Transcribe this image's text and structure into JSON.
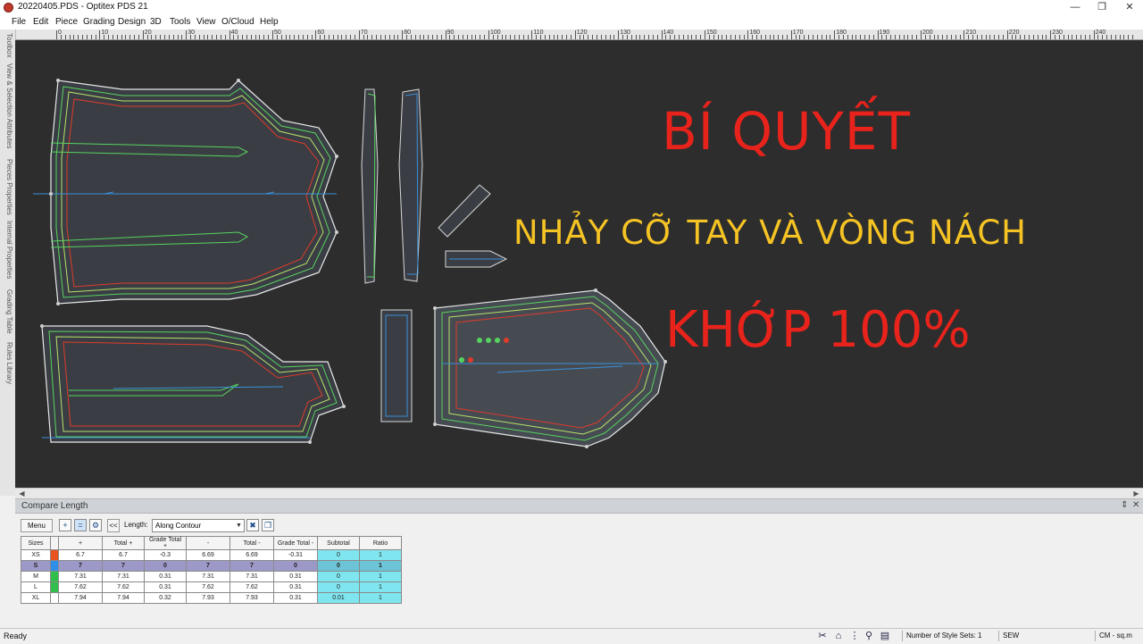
{
  "window": {
    "title": "20220405.PDS - Optitex PDS 21",
    "controls": {
      "minimize": "—",
      "maximize": "❐",
      "close": "✕"
    }
  },
  "menu": [
    "File",
    "Edit",
    "Piece",
    "Grading",
    "Design",
    "3D",
    "Tools",
    "View",
    "O/Cloud",
    "Help"
  ],
  "ruler": {
    "labels": [
      "0",
      "10",
      "20",
      "30",
      "40",
      "50",
      "60",
      "70",
      "80",
      "90",
      "100",
      "110",
      "120",
      "130",
      "140",
      "150",
      "160",
      "170",
      "180",
      "190",
      "200",
      "210",
      "220",
      "230",
      "240"
    ]
  },
  "side_tabs": [
    "Toolbox",
    "View & Selection Attributes",
    "Pieces Properties",
    "Internal Properties",
    "Grading Table",
    "Rules Library"
  ],
  "overlay": {
    "line1": "BÍ QUYẾT",
    "line2": "NHẢY CỠ TAY VÀ VÒNG NÁCH",
    "line3": "KHỚP 100%",
    "colors": {
      "red": "#e8231c",
      "yellow": "#f5c324"
    }
  },
  "panel": {
    "title": "Compare Length",
    "pin_icons": [
      "pin-icon",
      "close-icon"
    ],
    "menu_button": "Menu",
    "nav_button": "<<",
    "length_label": "Length:",
    "length_mode": "Along Contour",
    "table": {
      "headers": [
        "Sizes",
        "",
        "+",
        "Total +",
        "Grade Total +",
        "-",
        "Total -",
        "Grade Total -",
        "Subtotal",
        "Ratio"
      ],
      "rows": [
        {
          "size": "XS",
          "color": "#e8531f",
          "plus": "6.7",
          "total_plus": "6.7",
          "grade_plus": "-0.3",
          "minus": "6.69",
          "total_minus": "6.69",
          "grade_minus": "-0.31",
          "subtotal": "0",
          "ratio": "1"
        },
        {
          "size": "S",
          "color": "#2f8fe8",
          "plus": "7",
          "total_plus": "7",
          "grade_plus": "0",
          "minus": "7",
          "total_minus": "7",
          "grade_minus": "0",
          "subtotal": "0",
          "ratio": "1",
          "selected": true
        },
        {
          "size": "M",
          "color": "#2fbf4a",
          "plus": "7.31",
          "total_plus": "7.31",
          "grade_plus": "0.31",
          "minus": "7.31",
          "total_minus": "7.31",
          "grade_minus": "0.31",
          "subtotal": "0",
          "ratio": "1"
        },
        {
          "size": "L",
          "color": "#2fbf4a",
          "plus": "7.62",
          "total_plus": "7.62",
          "grade_plus": "0.31",
          "minus": "7.62",
          "total_minus": "7.62",
          "grade_minus": "0.31",
          "subtotal": "0",
          "ratio": "1"
        },
        {
          "size": "XL",
          "color": "#ffffff",
          "plus": "7.94",
          "total_plus": "7.94",
          "grade_plus": "0.32",
          "minus": "7.93",
          "total_minus": "7.93",
          "grade_minus": "0.31",
          "subtotal": "0.01",
          "ratio": "1"
        }
      ]
    }
  },
  "status": {
    "ready": "Ready",
    "style_sets": "Number of Style Sets: 1",
    "mode": "SEW",
    "units": "CM - sq.m"
  }
}
